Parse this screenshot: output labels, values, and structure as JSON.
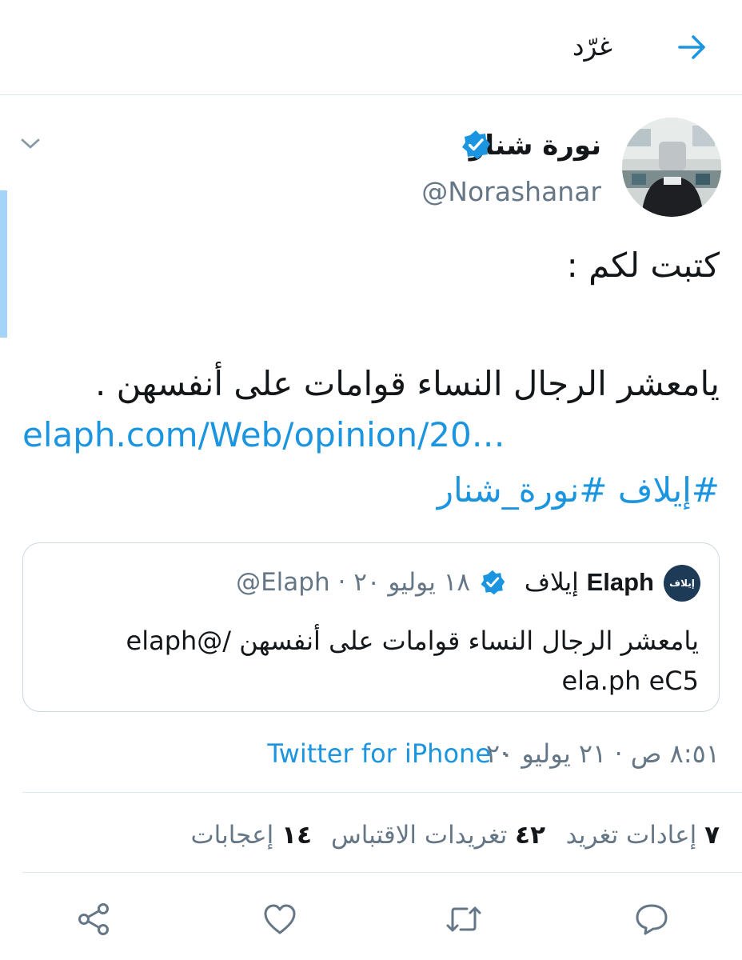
{
  "header": {
    "title": "غرّد"
  },
  "author": {
    "name": "نورة شنار",
    "handle": "@Norashanar"
  },
  "tweet": {
    "line_1": "كتبت لكم :",
    "line_2": "يامعشر الرجال النساء قوامات على أنفسهن .",
    "link": "elaph.com/Web/opinion/20…",
    "hashtags": "#إيلاف #نورة_شنار"
  },
  "quote": {
    "avatar_text": "إيلاف",
    "name_ar": "إيلاف",
    "name_en": "Elaph",
    "handle": "@Elaph",
    "date": "١٨ يوليو ٢٠",
    "text": "يامعشر الرجال النساء قوامات على أنفسهن  /@elaph ela.ph eC5"
  },
  "timestamp": {
    "time_date": "٨:٥١ ص · ٢١ يوليو ٢٠",
    "source": "Twitter for iPhone"
  },
  "stats": {
    "retweets_count": "٧",
    "retweets_label": "إعادات تغريد",
    "quotes_count": "٤٢",
    "quotes_label": "تغريدات الاقتباس",
    "likes_count": "١٤",
    "likes_label": "إعجابات"
  },
  "icons": {
    "back": "arrow-right-icon",
    "verified": "verified-badge-icon",
    "caret": "chevron-down-icon",
    "reply": "reply-icon",
    "retweet": "retweet-icon",
    "like": "heart-icon",
    "share": "share-icon"
  },
  "colors": {
    "accent": "#1b95e0",
    "secondary_text": "#657786",
    "border": "#e1e8ed",
    "highlight_bar": "#a4d4f7"
  }
}
